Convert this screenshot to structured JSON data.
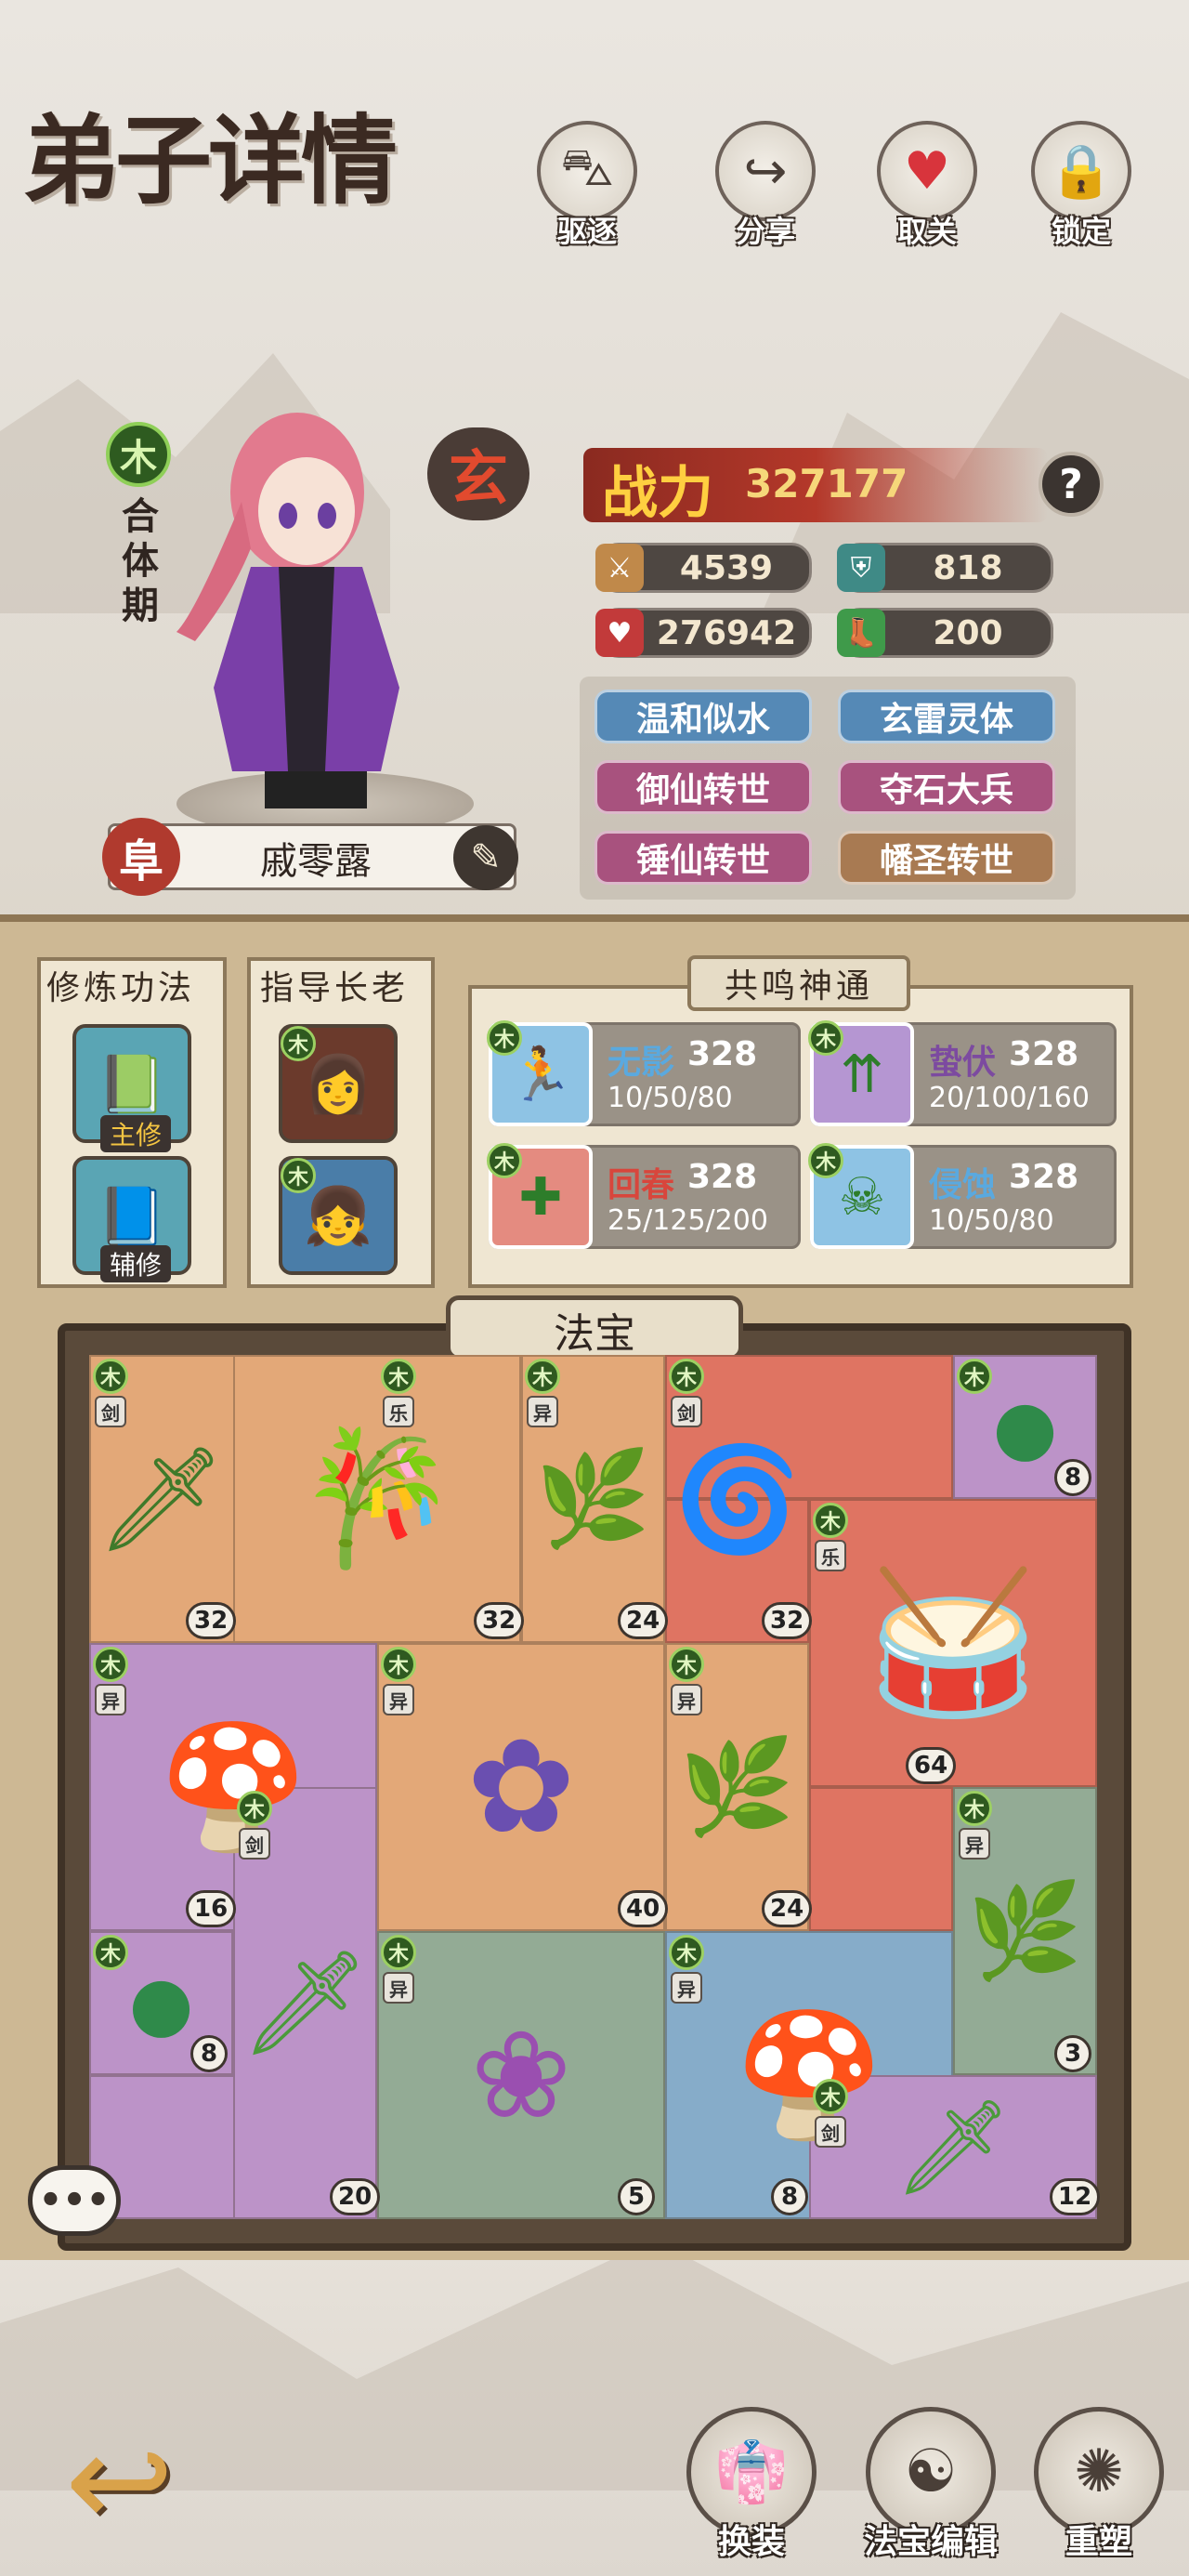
{
  "header": {
    "title": "弟子详情",
    "buttons": [
      {
        "label": "驱逐",
        "icon": "boot-icon"
      },
      {
        "label": "分享",
        "icon": "share-arrow-icon"
      },
      {
        "label": "取关",
        "icon": "heart-icon"
      },
      {
        "label": "锁定",
        "icon": "lock-icon"
      }
    ]
  },
  "character": {
    "element": "木",
    "realm": "合体期",
    "grade": "玄",
    "rank_badge": "阜",
    "name": "戚零露",
    "power_label": "战力",
    "power_value": "327177",
    "help": "?",
    "stats": {
      "attack": "4539",
      "defense": "818",
      "hp": "276942",
      "speed": "200"
    },
    "traits": [
      "温和似水",
      "玄雷灵体",
      "御仙转世",
      "夺石大兵",
      "锤仙转世",
      "幡圣转世"
    ]
  },
  "cultivation": {
    "title": "修炼功法",
    "main_label": "主修",
    "sub_label": "辅修"
  },
  "mentors": {
    "title": "指导长老",
    "elements": [
      "木",
      "木"
    ]
  },
  "resonance": {
    "title": "共鸣神通",
    "skills": [
      {
        "element": "木",
        "name": "无影",
        "level": "328",
        "values": "10/50/80"
      },
      {
        "element": "木",
        "name": "蛰伏",
        "level": "328",
        "values": "20/100/160"
      },
      {
        "element": "木",
        "name": "回春",
        "level": "328",
        "values": "25/125/200"
      },
      {
        "element": "木",
        "name": "侵蚀",
        "level": "328",
        "values": "10/50/80"
      }
    ]
  },
  "treasures": {
    "title": "法宝",
    "items": [
      {
        "element": "木",
        "type": "剑",
        "level": "32"
      },
      {
        "element": "木",
        "type": "乐",
        "level": "32"
      },
      {
        "element": "木",
        "type": "异",
        "level": "24"
      },
      {
        "element": "木",
        "type": "剑",
        "level": "32"
      },
      {
        "element": "木",
        "type": "",
        "level": "8"
      },
      {
        "element": "木",
        "type": "乐",
        "level": "64"
      },
      {
        "element": "木",
        "type": "异",
        "level": "16"
      },
      {
        "element": "木",
        "type": "异",
        "level": "40"
      },
      {
        "element": "木",
        "type": "异",
        "level": "24"
      },
      {
        "element": "木",
        "type": "剑",
        "level": "20"
      },
      {
        "element": "木",
        "type": "异",
        "level": "3"
      },
      {
        "element": "木",
        "type": "",
        "level": "8"
      },
      {
        "element": "木",
        "type": "异",
        "level": "5"
      },
      {
        "element": "木",
        "type": "异",
        "level": "8"
      },
      {
        "element": "木",
        "type": "剑",
        "level": "12"
      }
    ]
  },
  "footer": {
    "back_icon": "back-arrow-icon",
    "buttons": [
      {
        "label": "换装",
        "icon": "outfit-icon"
      },
      {
        "label": "法宝编辑",
        "icon": "treasure-edit-icon"
      },
      {
        "label": "重塑",
        "icon": "reshape-icon"
      }
    ]
  },
  "chat_icon": "chat-bubble-icon"
}
